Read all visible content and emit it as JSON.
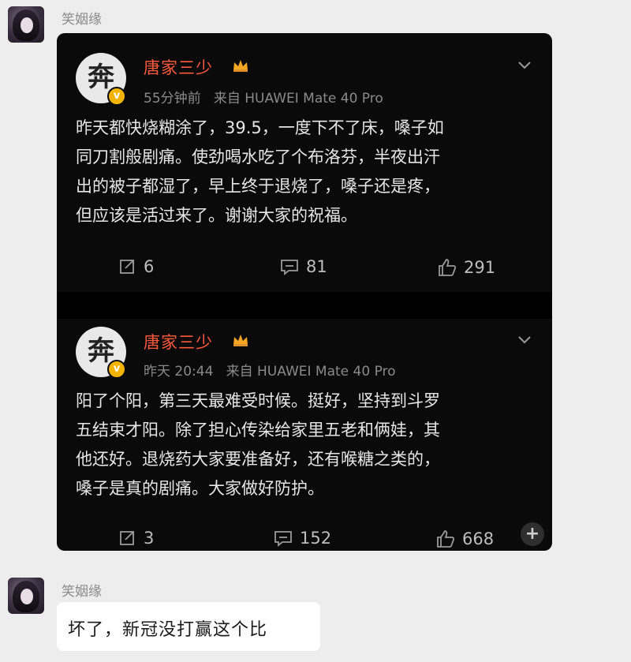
{
  "chat": {
    "messages": [
      {
        "sender": "笑姻缘",
        "type": "image"
      },
      {
        "sender": "笑姻缘",
        "type": "text",
        "text": "坏了，新冠没打赢这个比"
      }
    ]
  },
  "weibo": {
    "posts": [
      {
        "author": "唐家三少",
        "time": "55分钟前",
        "source": "来自 HUAWEI Mate 40 Pro",
        "lines": [
          "昨天都快烧糊涂了，39.5，一度下不了床，嗓子如",
          "同刀割般剧痛。使劲喝水吃了个布洛芬，半夜出汗",
          "出的被子都湿了，早上终于退烧了，嗓子还是疼，",
          "但应该是活过来了。谢谢大家的祝福。"
        ],
        "reposts": "6",
        "comments": "81",
        "likes": "291"
      },
      {
        "author": "唐家三少",
        "time": "昨天 20:44",
        "source": "来自 HUAWEI Mate 40 Pro",
        "lines": [
          "阳了个阳，第三天最难受时候。挺好，坚持到斗罗",
          "五结束才阳。除了担心传染给家里五老和俩娃，其",
          "他还好。退烧药大家要准备好，还有喉糖之类的，",
          "嗓子是真的剧痛。大家做好防护。"
        ],
        "reposts": "3",
        "comments": "152",
        "likes": "668"
      }
    ]
  },
  "colors": {
    "chat_background": "#ededed",
    "post_background": "#0a0a0a",
    "author_name": "#ff5a3c",
    "vip_badge": "#f2b400"
  },
  "icons": [
    "repost-icon",
    "comment-icon",
    "like-icon",
    "chevron-down-icon",
    "crown-icon",
    "verified-badge-icon",
    "plus-icon"
  ]
}
